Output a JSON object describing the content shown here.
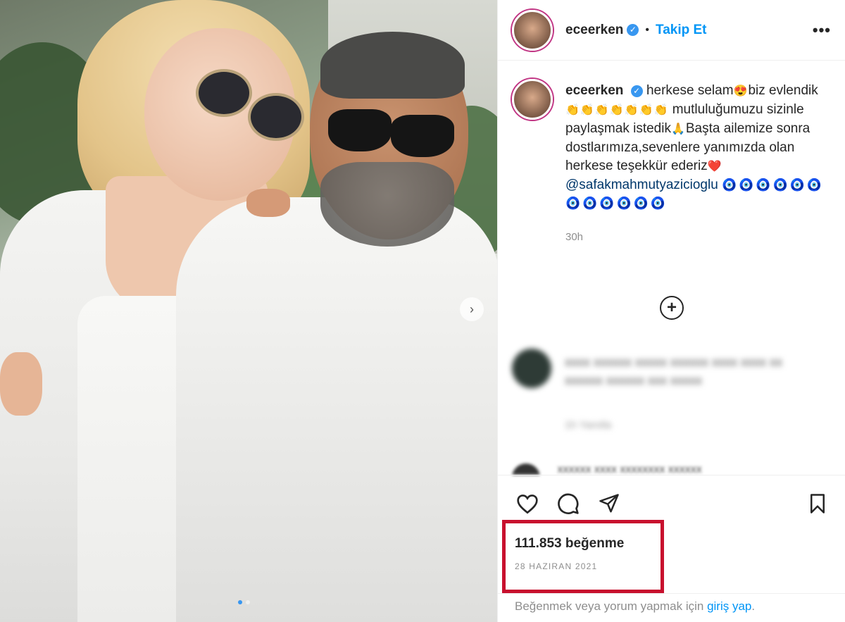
{
  "post": {
    "username": "eceerken",
    "follow_label": "Takip Et",
    "separator": "•",
    "more_label": "•••",
    "caption_text_1": "herkese selam",
    "caption_emoji_1": "😍",
    "caption_text_2": "biz evlendik",
    "caption_emoji_2": "👏👏👏👏👏👏👏",
    "caption_text_3": "mutluluğumuzu sizinle paylaşmak istedik",
    "caption_emoji_3": "🙏",
    "caption_text_4": "Başta ailemize sonra dostlarımıza,sevenlere yanımızda olan herkese teşekkür ederiz",
    "caption_heart": "❤️",
    "mention": "@safakmahmutyazicioglu",
    "evil_eyes_1": "🧿🧿🧿🧿🧿🧿",
    "evil_eyes_2": "🧿🧿🧿🧿🧿🧿",
    "time_ago": "30h",
    "load_more_label": "+",
    "likes": "111.853 beğenme",
    "date": "28 Haziran 2021",
    "footer_text": "Beğenmek veya yorum yapmak için ",
    "footer_link": "giriş yap",
    "footer_end": "."
  },
  "comments": [
    {
      "text": "xxxx xxxxxx xxxxx xxxxxx xxxx xxxx xx xxxxxx xxxxxx xxx xxxxx",
      "meta": "1h  Yanıtla"
    },
    {
      "text": "xxxxxx xxxx xxxxxxxx xxxxxx"
    }
  ],
  "photo": {
    "next_label": "›",
    "dots": 2
  },
  "colors": {
    "accent": "#0095f6",
    "highlight_box": "#c8102e",
    "verified": "#3897f0"
  },
  "icons": [
    "heart-icon",
    "comment-icon",
    "share-icon",
    "bookmark-icon",
    "verified-icon",
    "more-icon",
    "add-circle-icon",
    "chevron-right-icon"
  ]
}
